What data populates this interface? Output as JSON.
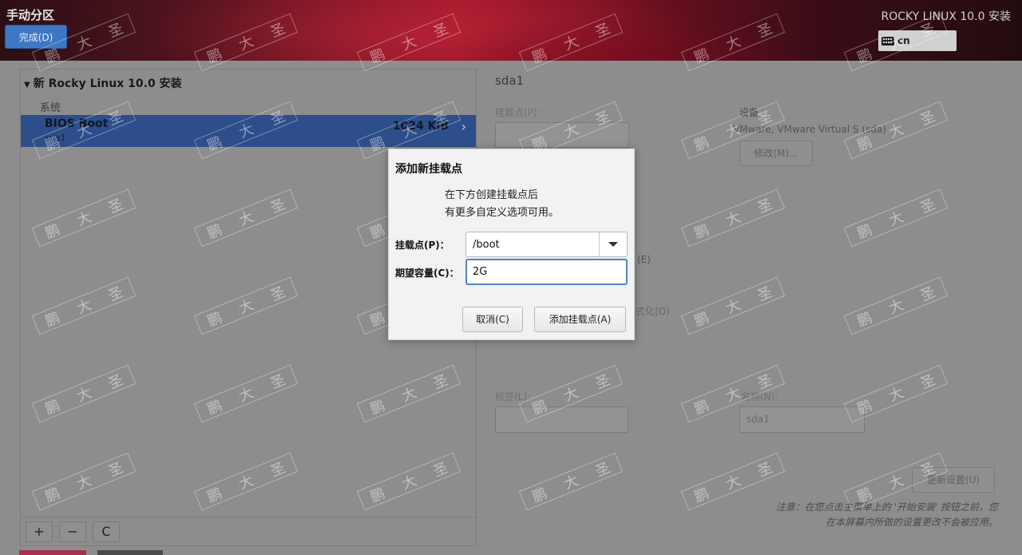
{
  "header": {
    "page_title": "手动分区",
    "done_label": "完成(D)",
    "product_title": "ROCKY LINUX 10.0 安装",
    "keyboard_layout": "cn"
  },
  "left_panel": {
    "install_header": "新 Rocky Linux 10.0 安装",
    "group_label": "系统",
    "partition": {
      "name": "BIOS Boot",
      "device": "sda1",
      "size": "1024 KiB"
    },
    "toolbar": {
      "add_label": "+",
      "remove_label": "−",
      "refresh_label": "C"
    }
  },
  "right_panel": {
    "title": "sda1",
    "mount_point_label": "挂载点(P):",
    "device_label": "设备",
    "device_value": "VMware, VMware Virtual S (sda)",
    "modify_label": "修改(M)...",
    "encrypt_fragment": "(E)",
    "reformat_fragment": "式化(O)",
    "label_label": "标签(L):",
    "name_label": "名称(N):",
    "name_value": "sda1",
    "update_label": "更新设置(U)",
    "note": "注意：在您点击主菜单上的 '开始安装' 按钮之前，您在本屏幕内所做的设置更改不会被应用。"
  },
  "dialog": {
    "title": "添加新挂载点",
    "message_line1": "在下方创建挂载点后",
    "message_line2": "有更多自定义选项可用。",
    "mount_point_label": "挂载点(P)：",
    "mount_point_value": "/boot",
    "capacity_label": "期望容量(C)：",
    "capacity_value": "2G",
    "cancel_label": "取消(C)",
    "add_label": "添加挂载点(A)"
  },
  "watermark": {
    "chars": [
      "鹏",
      "大",
      "圣"
    ]
  },
  "colors": {
    "selection": "#2d4e8a",
    "done_button": "#3e78c4",
    "focus_border": "#4a86cf"
  }
}
